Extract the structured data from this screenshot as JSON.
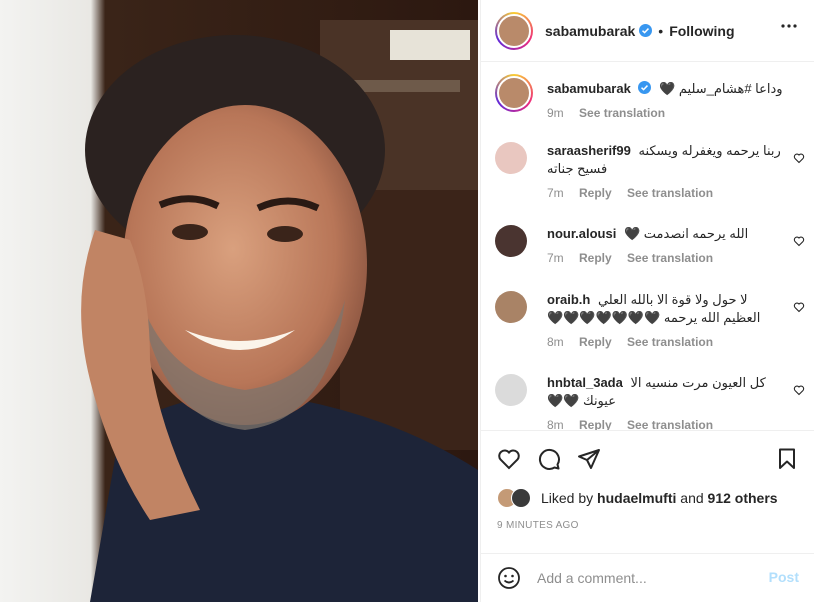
{
  "header": {
    "username": "sabamubarak",
    "separator": "•",
    "follow_status": "Following",
    "more_icon": "more-horizontal-icon"
  },
  "caption": {
    "username": "sabamubarak",
    "text": "وداعا #هشام_سليم 🖤",
    "time": "9m",
    "see_translation": "See translation"
  },
  "comments": [
    {
      "username": "saraasherif99",
      "text": "ربنا يرحمه ويغفرله ويسكنه فسيح جناته",
      "time": "7m",
      "reply": "Reply",
      "see_translation": "See translation"
    },
    {
      "username": "nour.alousi",
      "text": "الله يرحمه انصدمت 🖤",
      "time": "7m",
      "reply": "Reply",
      "see_translation": "See translation"
    },
    {
      "username": "oraib.h",
      "text": "لا حول ولا قوة الا بالله العلي العظيم الله يرحمه 🖤🖤🖤🖤🖤🖤🖤",
      "time": "8m",
      "reply": "Reply",
      "see_translation": "See translation"
    },
    {
      "username": "hnbtal_3ada",
      "text": "كل العيون مرت منسيه الا عيونك 🖤🖤",
      "time": "8m",
      "reply": "Reply",
      "see_translation": "See translation"
    }
  ],
  "likes": {
    "prefix": "Liked by",
    "user": "hudaelmufti",
    "and": "and",
    "others": "912 others"
  },
  "time_ago": "9 MINUTES AGO",
  "add_comment": {
    "placeholder": "Add a comment...",
    "post_label": "Post"
  },
  "colors": {
    "verified": "#3897f0",
    "post_disabled": "#b2dffc",
    "secondary_text": "#8e8e8e"
  }
}
